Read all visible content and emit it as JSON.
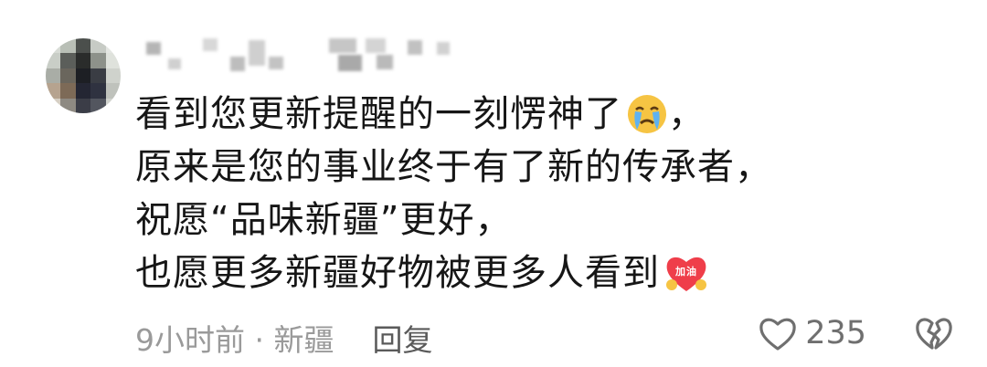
{
  "comment": {
    "lines": [
      "看到您更新提醒的一刻愣神了",
      "原来是您的事业终于有了新的传承者，",
      "祝愿“品味新疆”更好，",
      "也愿更多新疆好物被更多人看到"
    ],
    "line1_suffix": "，",
    "emoji_1": "crying-face-icon",
    "emoji_2": "cheer-heart-icon",
    "emoji_2_text": "加油"
  },
  "meta": {
    "time_location": "9小时前 · 新疆",
    "reply_label": "回复"
  },
  "actions": {
    "like_count": "235",
    "like_icon": "heart-outline-icon",
    "dislike_icon": "broken-heart-icon"
  },
  "colors": {
    "text": "#161616",
    "meta": "#9a9a9a",
    "reply": "#5a5a5a",
    "icon": "#6f6f6f"
  }
}
